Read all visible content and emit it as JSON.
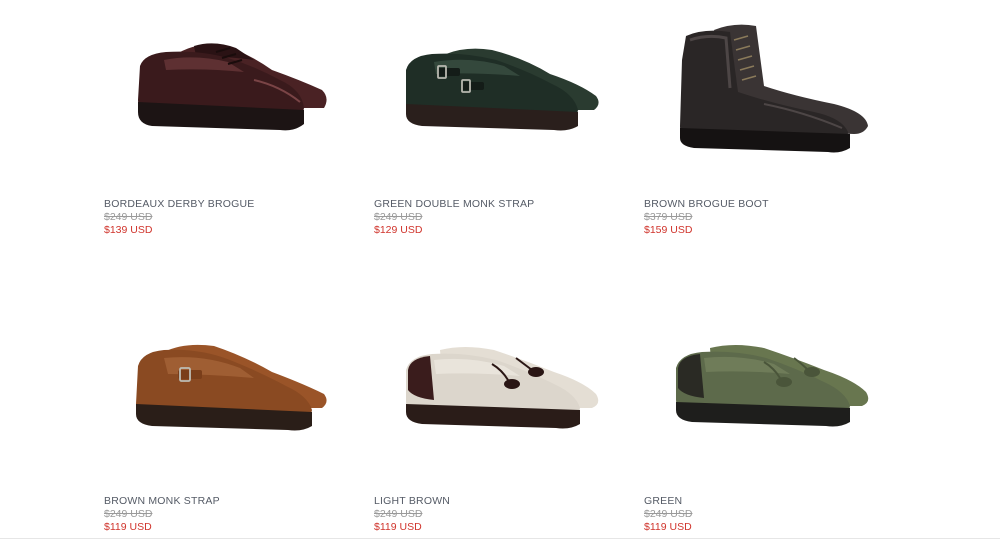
{
  "products": [
    {
      "name": "BORDEAUX DERBY BROGUE",
      "old_price": "$249 USD",
      "price": "$139 USD",
      "image": "bordeaux-derby-brogue-shoe",
      "colors": {
        "upper": "#3a1a1c",
        "highlight": "#6e3a3c",
        "sole": "#1c1414"
      }
    },
    {
      "name": "GREEN DOUBLE MONK STRAP",
      "old_price": "$249 USD",
      "price": "$129 USD",
      "image": "green-double-monk-strap-shoe",
      "colors": {
        "upper": "#1f2e26",
        "highlight": "#3d5446",
        "sole": "#2a1f1c"
      }
    },
    {
      "name": "BROWN BROGUE BOOT",
      "old_price": "$379 USD",
      "price": "$159 USD",
      "image": "brown-brogue-boot",
      "colors": {
        "upper": "#2a2626",
        "highlight": "#4d4646",
        "sole": "#151212"
      }
    },
    {
      "name": "BROWN MONK STRAP",
      "old_price": "$249 USD",
      "price": "$119 USD",
      "image": "brown-suede-monk-strap-shoe",
      "colors": {
        "upper": "#8a4a22",
        "highlight": "#a8663a",
        "sole": "#2a1e18"
      }
    },
    {
      "name": "LIGHT BROWN",
      "old_price": "$249 USD",
      "price": "$119 USD",
      "image": "linen-tassel-loafer",
      "colors": {
        "upper": "#dcd6cc",
        "highlight": "#ece7df",
        "sole": "#2a1c18"
      }
    },
    {
      "name": "GREEN",
      "old_price": "$249 USD",
      "price": "$119 USD",
      "image": "green-suede-tassel-loafer",
      "colors": {
        "upper": "#5d6a4b",
        "highlight": "#77845f",
        "sole": "#1e1e1c"
      }
    }
  ]
}
